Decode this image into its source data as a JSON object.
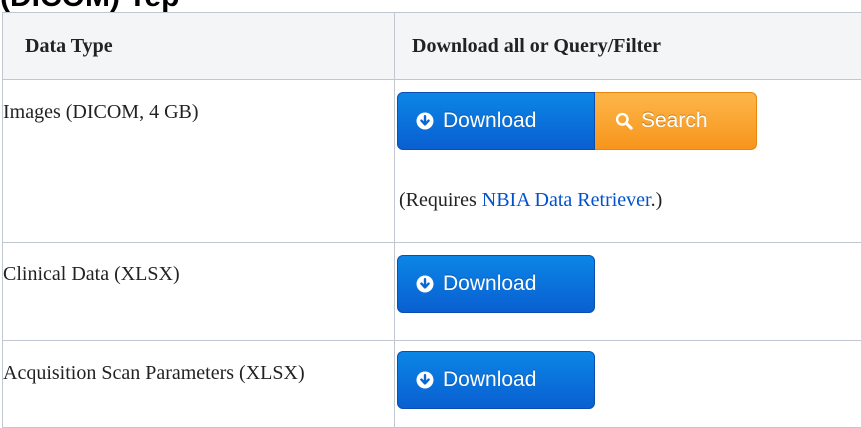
{
  "heading": "(DICOM) Tep",
  "table": {
    "headers": {
      "col1": "Data Type",
      "col2": "Download all or Query/Filter"
    },
    "rows": [
      {
        "data_type": "Images (DICOM, 4 GB)",
        "download_label": "Download",
        "search_label": "Search",
        "note_prefix": "(Requires ",
        "note_link": "NBIA Data Retriever",
        "note_suffix": ".)"
      },
      {
        "data_type": "Clinical Data (XLSX)",
        "download_label": "Download"
      },
      {
        "data_type": "Acquisition Scan Parameters (XLSX)",
        "download_label": "Download"
      }
    ]
  },
  "colors": {
    "download_button": "#0a6fdc",
    "search_button": "#f9a52b",
    "link": "#0052cc",
    "header_background": "#f4f5f7",
    "border": "#c1c7d0"
  },
  "icons": {
    "download": "download-circle-icon",
    "search": "magnifier-icon"
  }
}
